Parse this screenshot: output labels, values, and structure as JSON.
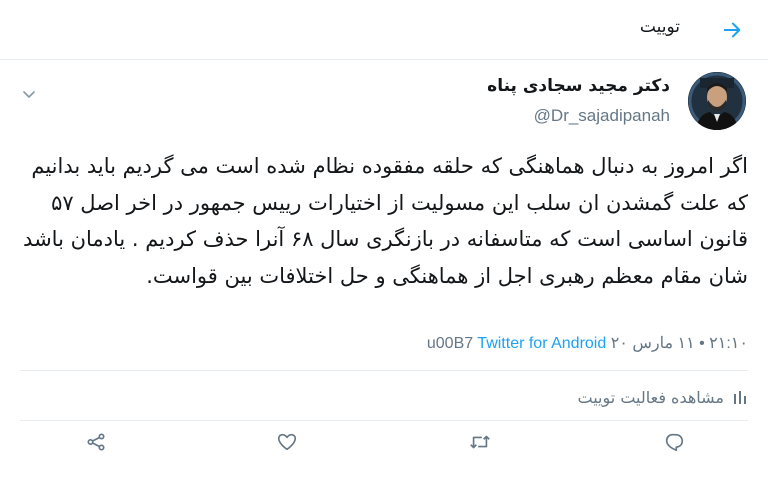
{
  "header": {
    "title": "توییت",
    "back_icon": "arrow-right-icon",
    "accent": "#1da1f2"
  },
  "author": {
    "display_name": "دکتر مجید سجادی پناه",
    "handle": "@Dr_sajadipanah"
  },
  "tweet": {
    "text": "اگر امروز به دنبال هماهنگی که حلقه مفقوده نظام شده است می گردیم باید بدانیم که علت گمشدن ان سلب این مسولیت از اختیارات رییس جمهور در اخر اصل ۵۷ قانون اساسی است که متاسفانه در بازنگری سال ۶۸ آنرا حذف کردیم . یادمان باشد شان مقام معظم رهبری اجل از هماهنگی و حل اختلافات بین قواست.",
    "timestamp": "۲۱:۱۰ • ۱۱ مارس ۲۰",
    "separator": "u00B7",
    "source": "Twitter for Android"
  },
  "activity": {
    "label": "مشاهده فعالیت توییت"
  },
  "actions": [
    "reply-icon",
    "retweet-icon",
    "like-icon",
    "share-icon"
  ],
  "colors": {
    "text": "#14171a",
    "muted": "#657786",
    "link": "#1da1f2",
    "border": "#e6ecf0"
  }
}
